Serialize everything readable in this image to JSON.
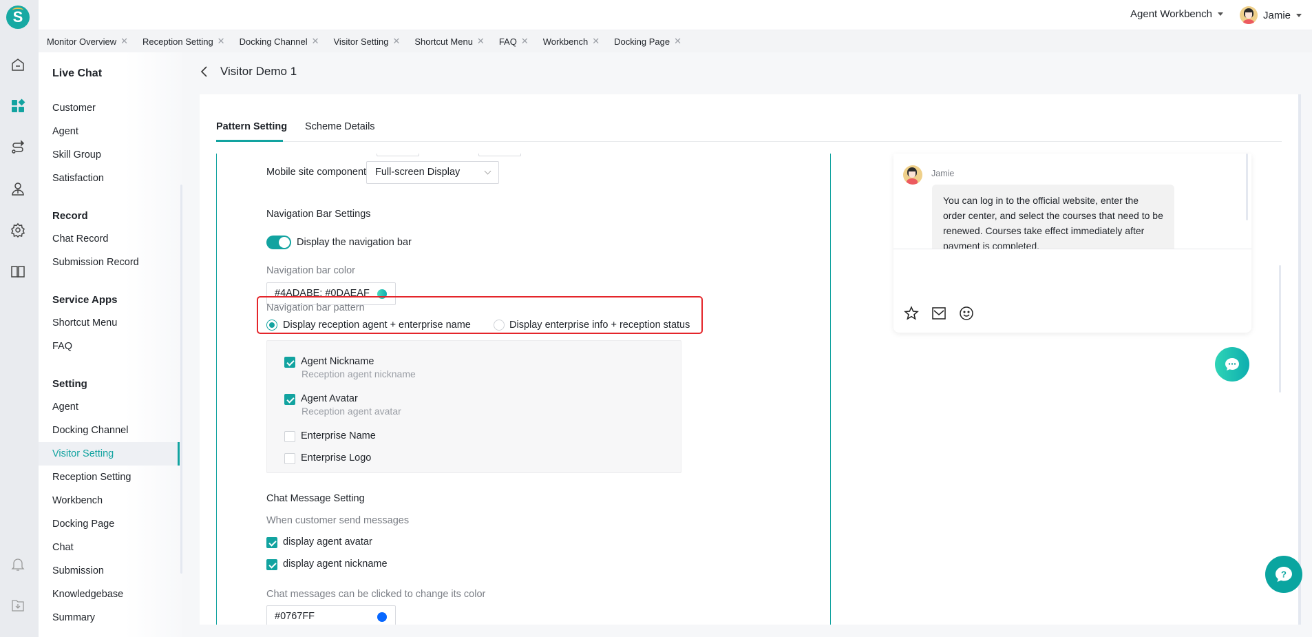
{
  "app": {
    "logo_letter": "S"
  },
  "rail": {
    "icons": [
      "home-icon",
      "dashboard-grid-icon",
      "route-icon",
      "agent-icon",
      "settings-gear-icon",
      "book-icon",
      "bell-icon",
      "download-folder-icon"
    ]
  },
  "header": {
    "workbench_label": "Agent Workbench",
    "user_name": "Jamie"
  },
  "open_tabs": [
    {
      "label": "Monitor Overview"
    },
    {
      "label": "Reception Setting"
    },
    {
      "label": "Docking Channel"
    },
    {
      "label": "Visitor Setting"
    },
    {
      "label": "Shortcut Menu"
    },
    {
      "label": "FAQ"
    },
    {
      "label": "Workbench"
    },
    {
      "label": "Docking Page"
    }
  ],
  "sidebar": {
    "title": "Live Chat",
    "groups": [
      {
        "label": "",
        "items": [
          "Customer",
          "Agent",
          "Skill Group",
          "Satisfaction"
        ]
      },
      {
        "label": "Record",
        "items": [
          "Chat Record",
          "Submission Record"
        ]
      },
      {
        "label": "Service Apps",
        "items": [
          "Shortcut Menu",
          "FAQ"
        ]
      },
      {
        "label": "Setting",
        "items": [
          "Agent",
          "Docking Channel",
          "Visitor Setting",
          "Reception Setting",
          "Workbench",
          "Docking Page",
          "Chat",
          "Submission",
          "Knowledgebase",
          "Summary"
        ]
      }
    ],
    "active_item": "Visitor Setting"
  },
  "page": {
    "title": "Visitor Demo 1",
    "tabs": [
      {
        "label": "Pattern Setting",
        "active": true
      },
      {
        "label": "Scheme Details",
        "active": false
      }
    ]
  },
  "form": {
    "mobile_component_label": "Mobile site component",
    "mobile_component_value": "Full-screen Display",
    "nav_settings_title": "Navigation Bar Settings",
    "nav_toggle_label": "Display the navigation bar",
    "nav_toggle_on": true,
    "nav_color_label": "Navigation bar color",
    "nav_color_value": "#4ADABE; #0DAEAF",
    "nav_pattern_label": "Navigation bar pattern",
    "nav_pattern_options": [
      {
        "label": "Display reception agent + enterprise name",
        "selected": true
      },
      {
        "label": "Display enterprise info + reception status",
        "selected": false
      }
    ],
    "display_options": [
      {
        "label": "Agent Nickname",
        "sub": "Reception agent nickname",
        "checked": true
      },
      {
        "label": "Agent Avatar",
        "sub": "Reception agent avatar",
        "checked": true
      },
      {
        "label": "Enterprise Name",
        "sub": "",
        "checked": false
      },
      {
        "label": "Enterprise Logo",
        "sub": "",
        "checked": false
      }
    ],
    "chat_msg_title": "Chat Message Setting",
    "chat_msg_sub": "When customer send messages",
    "chat_msg_options": [
      {
        "label": "display agent avatar",
        "checked": true
      },
      {
        "label": "display agent nickname",
        "checked": true
      }
    ],
    "chat_color_label": "Chat messages can be clicked to change its color",
    "chat_color_value": "#0767FF"
  },
  "preview": {
    "agent_name": "Jamie",
    "message": "You can log in to the official website, enter the order center, and select the courses that need to be renewed. Courses take effect immediately after payment is completed."
  },
  "colors": {
    "accent": "#12A3A0",
    "highlight_box": "#E4252A",
    "nav_dot": "#13B5A8",
    "chat_dot": "#0767FF"
  }
}
